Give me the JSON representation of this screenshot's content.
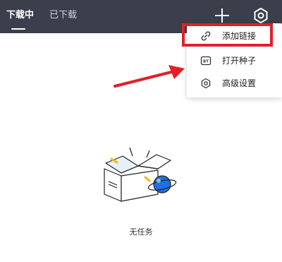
{
  "tabs": {
    "downloading": "下载中",
    "downloaded": "已下载"
  },
  "toolbar": {
    "add_icon": "plus-icon",
    "settings_icon": "gear-icon"
  },
  "menu": {
    "items": [
      {
        "label": "添加链接",
        "icon": "link-icon"
      },
      {
        "label": "打开种子",
        "icon": "bt-torrent-icon",
        "icon_text": "BT"
      },
      {
        "label": "高级设置",
        "icon": "hexagon-settings-icon"
      }
    ]
  },
  "empty_state": {
    "text": "无任务",
    "illustration": "empty-box-globe-illustration"
  },
  "colors": {
    "topbar": "#3b3f4b",
    "annotation_red": "#e0202a",
    "globe_blue": "#1e6fe8",
    "accent_yellow": "#f5b800"
  }
}
